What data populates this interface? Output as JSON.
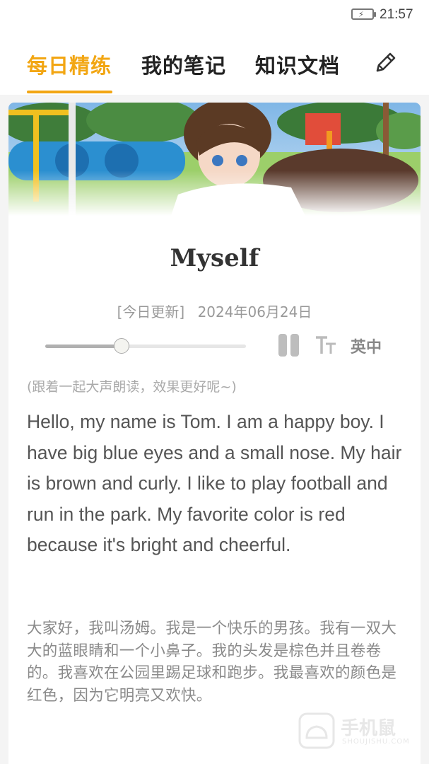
{
  "status_bar": {
    "time": "21:57",
    "battery_icon": "battery-charging-icon"
  },
  "tabs": [
    {
      "label": "每日精练",
      "active": true
    },
    {
      "label": "我的笔记",
      "active": false
    },
    {
      "label": "知识文档",
      "active": false
    }
  ],
  "toolbar": {
    "edit_icon": "pencil-icon"
  },
  "accent_color": "#f2a613",
  "article": {
    "title": "Myself",
    "date_tag": "[今日更新]",
    "date": "2024年06月24日",
    "audio": {
      "progress": 0.38,
      "pause_icon": "pause-icon",
      "font_icon": "font-size-icon",
      "lang_label": "英中"
    },
    "hint": "(跟着一起大声朗读，效果更好呢~)",
    "en_text": "Hello, my name is Tom. I am a happy boy. I have big blue eyes and a small nose. My hair is brown and curly. I like to play football and run in the park. My favorite color is red because it's bright and cheerful.",
    "zh_text": "大家好，我叫汤姆。我是一个快乐的男孩。我有一双大大的蓝眼睛和一个小鼻子。我的头发是棕色并且卷卷的。我喜欢在公园里踢足球和跑步。我最喜欢的颜色是红色，因为它明亮又欢快。"
  },
  "watermark": {
    "text": "手机鼠",
    "sub": "SHOUJISHU.COM"
  }
}
